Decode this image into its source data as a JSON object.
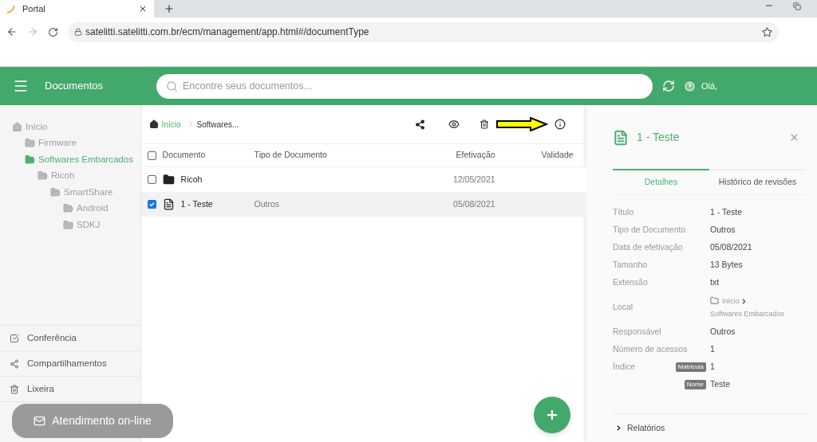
{
  "browser": {
    "tab_title": "Portal",
    "url": "satelitti.satelitti.com.br/ecm/management/app.html#/documentType"
  },
  "header": {
    "title": "Documentos",
    "search": {
      "placeholder": "Encontre seus documentos..."
    },
    "greeting": "Olá,"
  },
  "tree": [
    {
      "label": "Início",
      "kind": "home",
      "selected": false,
      "expanded": true,
      "children": [
        {
          "label": "Firmware",
          "kind": "folder",
          "selected": false,
          "expanded": false
        },
        {
          "label": "Softwares Embarcados",
          "kind": "folder",
          "selected": true,
          "expanded": true,
          "children": [
            {
              "label": "Ricoh",
              "kind": "folder",
              "selected": false,
              "expanded": true,
              "children": [
                {
                  "label": "SmartShare",
                  "kind": "folder",
                  "selected": false,
                  "expanded": true,
                  "children": [
                    {
                      "label": "Android",
                      "kind": "folder",
                      "selected": false,
                      "expanded": true
                    },
                    {
                      "label": "SDKJ",
                      "kind": "folder",
                      "selected": false,
                      "expanded": false
                    }
                  ]
                }
              ]
            }
          ]
        }
      ]
    }
  ],
  "sidebar_menu": [
    {
      "label": "Conferência",
      "kind": "check"
    },
    {
      "label": "Compartilhamentos",
      "kind": "share"
    },
    {
      "label": "Lixeira",
      "kind": "trash"
    }
  ],
  "chat_button": "Atendimento on-line",
  "breadcrumb": [
    {
      "label": "Início",
      "kind": "home"
    },
    {
      "label": "Softwares...",
      "kind": "current"
    }
  ],
  "table": {
    "select_all_checked": false,
    "columns": [
      "Documento",
      "Tipo de Documento",
      "Efetivação",
      "Validade"
    ],
    "rows": [
      {
        "kind": "folder",
        "name": "Ricoh",
        "type": "",
        "date": "12/05/2021",
        "checked": false,
        "selected": false
      },
      {
        "kind": "document",
        "name": "1 - Teste",
        "type": "Outros",
        "date": "05/08/2021",
        "checked": true,
        "selected": true
      }
    ]
  },
  "details": {
    "title": "1 - Teste",
    "tabs": [
      {
        "label": "Detalhes",
        "selected": true
      },
      {
        "label": "Histórico de revisões",
        "selected": false
      }
    ],
    "fields": [
      {
        "kind": "text",
        "label": "Título",
        "value": "1 - Teste"
      },
      {
        "kind": "text",
        "label": "Tipo de Documento",
        "value": "Outros"
      },
      {
        "kind": "text",
        "label": "Data de efetivação",
        "value": "05/08/2021"
      },
      {
        "kind": "text",
        "label": "Tamanho",
        "value": "13 Bytes"
      },
      {
        "kind": "text",
        "label": "Extensão",
        "value": "txt"
      },
      {
        "kind": "path",
        "label": "Local",
        "path": [
          "Início",
          "Softwares Embarcados"
        ]
      },
      {
        "kind": "text",
        "label": "Responsável",
        "value": "Outros"
      },
      {
        "kind": "text",
        "label": "Número de acessos",
        "value": "1"
      },
      {
        "kind": "index",
        "label": "Índice",
        "entries": [
          {
            "tag": "Matricula",
            "value": "1"
          },
          {
            "tag": "Nome",
            "value": "Teste"
          }
        ]
      }
    ],
    "section": "Relatórios"
  }
}
